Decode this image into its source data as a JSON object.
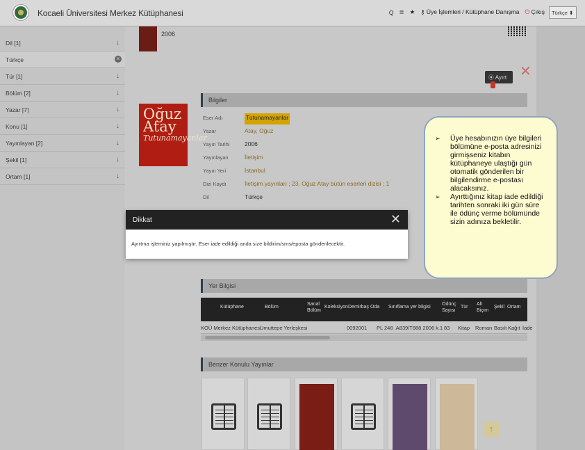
{
  "header": {
    "site_title": "Kocaeli Üniversitesi Merkez Kütüphanesi",
    "tools": [
      "Q",
      "≣",
      "★",
      "Üye İşlemleri / Kütüphane Danışma",
      "Çıkış"
    ],
    "language": "Türkçe"
  },
  "sidebar": {
    "items": [
      {
        "label": "Dil [1]"
      },
      {
        "label": "Türkçe"
      },
      {
        "label": "Tür [1]"
      },
      {
        "label": "Bölüm [2]"
      },
      {
        "label": "Yazar [7]"
      },
      {
        "label": "Konu [1]"
      },
      {
        "label": "Yayınlayan [2]"
      },
      {
        "label": "Şekil [1]"
      },
      {
        "label": "Ortam [1]"
      }
    ]
  },
  "main": {
    "top_year": "2006",
    "reserve_button": "Ayırt",
    "info_section": "Bilgiler",
    "info": [
      {
        "label": "Eser Adı",
        "value": "Tutunamayanlar"
      },
      {
        "label": "Yazar",
        "value": "Atay, Oğuz"
      },
      {
        "label": "Yayın Tarihi",
        "value": "2006"
      },
      {
        "label": "Yayınlayan",
        "value": "İletişim"
      },
      {
        "label": "Yayın Yeri",
        "value": "İstanbul"
      },
      {
        "label": "Dizi Kaydı",
        "value": "İletişim yayınları ; 23. Oğuz Atay bütün eserleri dizisi ; 1"
      },
      {
        "label": "Dil",
        "value": "Türkçe"
      }
    ],
    "cover": {
      "title": "Oğuz Atay",
      "subtitle": "Tutunamayanlar"
    },
    "location_section": "Yer Bilgisi",
    "table_headers": [
      "Kütüphane",
      "Bölüm",
      "Sanal Bölüm",
      "Koleksiyon",
      "Demirbaş",
      "Oda",
      "Sınıflama yer bilgisi",
      "Ödünç Sayısı",
      "Tür",
      "Alt Biçim",
      "Şekil",
      "Ortam"
    ],
    "table_row": [
      "KOÜ Merkez Kütüphanesi",
      "Umuttepe Yerleşkesi",
      "",
      "",
      "0092001",
      "",
      "PL 248 .A839/T888 2006 k.1",
      "83",
      "Kitap",
      "Roman",
      "Basılı",
      "Kağıt",
      "İade"
    ],
    "similar_section": "Benzer Konulu Yayınlar"
  },
  "modal": {
    "title": "Dikkat",
    "message": "Ayırtma işleminiz yapılmıştır. Eser iade edildiği anda size bildirim/sms/eposta gönderilecektir."
  },
  "callout": {
    "bullets": [
      "Üye hesabınızın üye bilgileri bölümüne e-posta adresinizi girmişseniz kitabın kütüphaneye ulaştığı gün otomatik gönderilen bir bilgilendirme e-postası alacaksınız.",
      "Ayırttığınız kitap iade edildiği tarihten sonraki iki gün süre ile ödünç verme bölümünde sizin adınıza bekletilir."
    ]
  }
}
